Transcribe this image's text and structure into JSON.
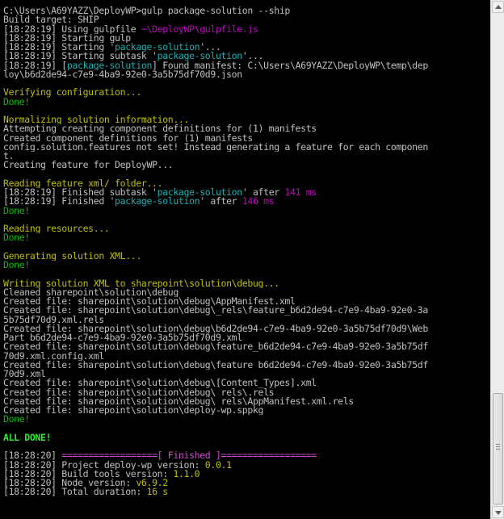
{
  "colors": {
    "white": "#c0c0c0",
    "gray": "#a8a8a8",
    "yellow": "#c0c000",
    "green": "#00c000",
    "bgreen": "#2ee82e",
    "cyan": "#1bb1b1",
    "magenta": "#c000c0",
    "pink": "#d050d0"
  },
  "console": {
    "lines": [
      [
        {
          "t": "C:\\Users\\A69YAZZ\\DeployWP>gulp package-solution --ship",
          "c": "white"
        }
      ],
      [
        {
          "t": "Build target: SHIP",
          "c": "white"
        }
      ],
      [
        {
          "t": "[18:28:19] Using gulpfile ",
          "c": "white"
        },
        {
          "t": "~\\DeployWP\\gulpfile.js",
          "c": "magenta"
        }
      ],
      [
        {
          "t": "[18:28:19] Starting gulp",
          "c": "white"
        }
      ],
      [
        {
          "t": "[18:28:19] Starting '",
          "c": "white"
        },
        {
          "t": "package-solution",
          "c": "cyan"
        },
        {
          "t": "'...",
          "c": "white"
        }
      ],
      [
        {
          "t": "[18:28:19] Starting subtask '",
          "c": "white"
        },
        {
          "t": "package-solution",
          "c": "cyan"
        },
        {
          "t": "'...",
          "c": "white"
        }
      ],
      [
        {
          "t": "[18:28:19] [",
          "c": "white"
        },
        {
          "t": "package-solution",
          "c": "cyan"
        },
        {
          "t": "] Found manifest: C:\\Users\\A69YAZZ\\DeployWP\\temp\\dep",
          "c": "white"
        }
      ],
      [
        {
          "t": "loy\\b6d2de94-c7e9-4ba9-92e0-3a5b75df70d9.json",
          "c": "white"
        }
      ],
      [
        {
          "t": "",
          "c": "white"
        }
      ],
      [
        {
          "t": "Verifying configuration...",
          "c": "yellow"
        }
      ],
      [
        {
          "t": "Done!",
          "c": "green"
        }
      ],
      [
        {
          "t": "",
          "c": "white"
        }
      ],
      [
        {
          "t": "Normalizing solution information...",
          "c": "yellow"
        }
      ],
      [
        {
          "t": "Attempting creating component definitions for (1) manifests",
          "c": "white"
        }
      ],
      [
        {
          "t": "Created component definitions for (1) manifests",
          "c": "white"
        }
      ],
      [
        {
          "t": "config.solution.features not set! Instead generating a feature for each componen",
          "c": "white"
        }
      ],
      [
        {
          "t": "t.",
          "c": "white"
        }
      ],
      [
        {
          "t": "Creating feature for DeployWP...",
          "c": "white"
        }
      ],
      [
        {
          "t": "",
          "c": "white"
        }
      ],
      [
        {
          "t": "Reading feature_xml/ folder...",
          "c": "yellow"
        }
      ],
      [
        {
          "t": "[18:28:19] Finished subtask '",
          "c": "white"
        },
        {
          "t": "package-solution",
          "c": "cyan"
        },
        {
          "t": "' after ",
          "c": "white"
        },
        {
          "t": "141 ms",
          "c": "magenta"
        }
      ],
      [
        {
          "t": "[18:28:19] Finished '",
          "c": "white"
        },
        {
          "t": "package-solution",
          "c": "cyan"
        },
        {
          "t": "' after ",
          "c": "white"
        },
        {
          "t": "146 ms",
          "c": "magenta"
        }
      ],
      [
        {
          "t": "Done!",
          "c": "green"
        }
      ],
      [
        {
          "t": "",
          "c": "white"
        }
      ],
      [
        {
          "t": "Reading resources...",
          "c": "yellow"
        }
      ],
      [
        {
          "t": "Done!",
          "c": "green"
        }
      ],
      [
        {
          "t": "",
          "c": "white"
        }
      ],
      [
        {
          "t": "Generating solution XML...",
          "c": "yellow"
        }
      ],
      [
        {
          "t": "Done!",
          "c": "green"
        }
      ],
      [
        {
          "t": "",
          "c": "white"
        }
      ],
      [
        {
          "t": "Writing solution XML to sharepoint\\solution\\debug...",
          "c": "yellow"
        }
      ],
      [
        {
          "t": "Cleaned sharepoint\\solution\\debug",
          "c": "white"
        }
      ],
      [
        {
          "t": "Created file: sharepoint\\solution\\debug\\AppManifest.xml",
          "c": "white"
        }
      ],
      [
        {
          "t": "Created file: sharepoint\\solution\\debug\\_rels\\feature_b6d2de94-c7e9-4ba9-92e0-3a",
          "c": "white"
        }
      ],
      [
        {
          "t": "5b75df70d9.xml.rels",
          "c": "white"
        }
      ],
      [
        {
          "t": "Created file: sharepoint\\solution\\debug\\b6d2de94-c7e9-4ba9-92e0-3a5b75df70d9\\Web",
          "c": "white"
        }
      ],
      [
        {
          "t": "Part_b6d2de94-c7e9-4ba9-92e0-3a5b75df70d9.xml",
          "c": "white"
        }
      ],
      [
        {
          "t": "Created file: sharepoint\\solution\\debug\\feature_b6d2de94-c7e9-4ba9-92e0-3a5b75df",
          "c": "white"
        }
      ],
      [
        {
          "t": "70d9.xml.config.xml",
          "c": "white"
        }
      ],
      [
        {
          "t": "Created file: sharepoint\\solution\\debug\\feature_b6d2de94-c7e9-4ba9-92e0-3a5b75df",
          "c": "white"
        }
      ],
      [
        {
          "t": "70d9.xml",
          "c": "white"
        }
      ],
      [
        {
          "t": "Created file: sharepoint\\solution\\debug\\[Content_Types].xml",
          "c": "white"
        }
      ],
      [
        {
          "t": "Created file: sharepoint\\solution\\debug\\_rels\\.rels",
          "c": "white"
        }
      ],
      [
        {
          "t": "Created file: sharepoint\\solution\\debug\\_rels\\AppManifest.xml.rels",
          "c": "white"
        }
      ],
      [
        {
          "t": "Created file: sharepoint\\solution\\deploy-wp.sppkg",
          "c": "white"
        }
      ],
      [
        {
          "t": "Done!",
          "c": "green"
        }
      ],
      [
        {
          "t": "",
          "c": "white"
        }
      ],
      [
        {
          "t": "ALL DONE!",
          "c": "bgreen"
        }
      ],
      [
        {
          "t": "",
          "c": "white"
        }
      ],
      [
        {
          "t": "[18:28:20] ",
          "c": "white"
        },
        {
          "t": "==================[ Finished ]==================",
          "c": "pink"
        }
      ],
      [
        {
          "t": "[18:28:20] Project deploy-wp version: ",
          "c": "white"
        },
        {
          "t": "0.0.1",
          "c": "yellow"
        }
      ],
      [
        {
          "t": "[18:28:20] Build tools version: ",
          "c": "white"
        },
        {
          "t": "1.1.0",
          "c": "yellow"
        }
      ],
      [
        {
          "t": "[18:28:20] Node version: ",
          "c": "white"
        },
        {
          "t": "v6.9.2",
          "c": "yellow"
        }
      ],
      [
        {
          "t": "[18:28:20] Total duration: ",
          "c": "white"
        },
        {
          "t": "16 s",
          "c": "yellow"
        }
      ]
    ]
  },
  "scrollbar": {
    "icon_up": "scroll-up-arrow",
    "icon_down": "scroll-down-arrow"
  }
}
